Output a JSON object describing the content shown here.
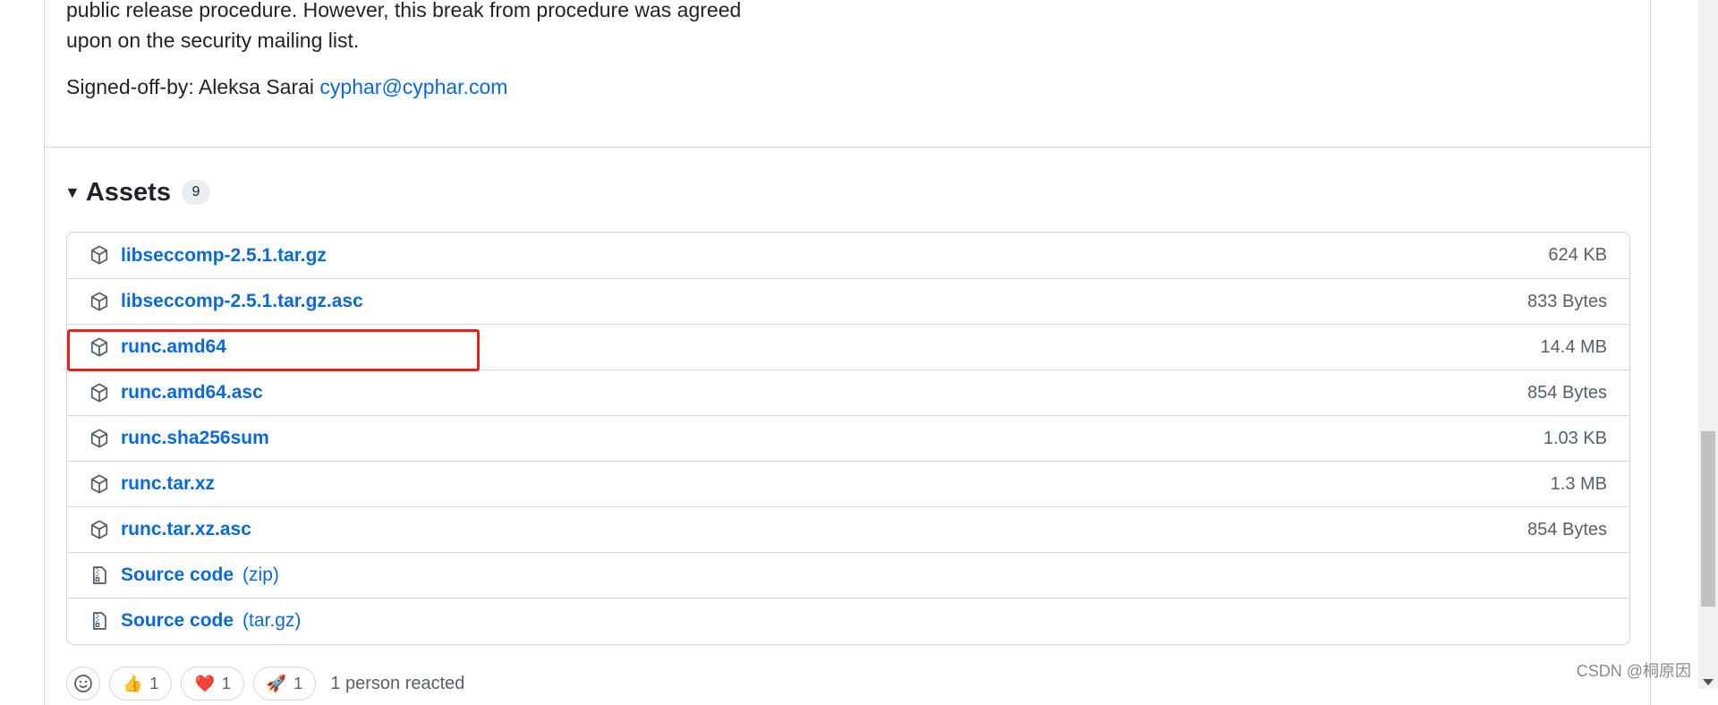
{
  "release_notes": {
    "line1": "public release procedure. However, this break from procedure was agreed",
    "line2": "upon on the security mailing list.",
    "signed_prefix": "Signed-off-by: Aleksa Sarai ",
    "signed_email": "cyphar@cyphar.com"
  },
  "assets": {
    "title": "Assets",
    "count": "9",
    "items": [
      {
        "name": "libseccomp-2.5.1.tar.gz",
        "size": "624 KB",
        "icon": "package-icon"
      },
      {
        "name": "libseccomp-2.5.1.tar.gz.asc",
        "size": "833 Bytes",
        "icon": "package-icon"
      },
      {
        "name": "runc.amd64",
        "size": "14.4 MB",
        "icon": "package-icon"
      },
      {
        "name": "runc.amd64.asc",
        "size": "854 Bytes",
        "icon": "package-icon"
      },
      {
        "name": "runc.sha256sum",
        "size": "1.03 KB",
        "icon": "package-icon"
      },
      {
        "name": "runc.tar.xz",
        "size": "1.3 MB",
        "icon": "package-icon"
      },
      {
        "name": "runc.tar.xz.asc",
        "size": "854 Bytes",
        "icon": "package-icon"
      },
      {
        "name": "Source code",
        "format": "(zip)",
        "icon": "file-zip-icon"
      },
      {
        "name": "Source code",
        "format": "(tar.gz)",
        "icon": "file-zip-icon"
      }
    ]
  },
  "reactions": {
    "items": [
      {
        "emoji": "👍",
        "count": "1"
      },
      {
        "emoji": "❤️",
        "count": "1"
      },
      {
        "emoji": "🚀",
        "count": "1"
      }
    ],
    "summary": "1 person reacted"
  },
  "watermark": "CSDN @桐原因",
  "colors": {
    "link": "#0969da",
    "highlight": "#e5231a",
    "border": "#d0d7de"
  }
}
